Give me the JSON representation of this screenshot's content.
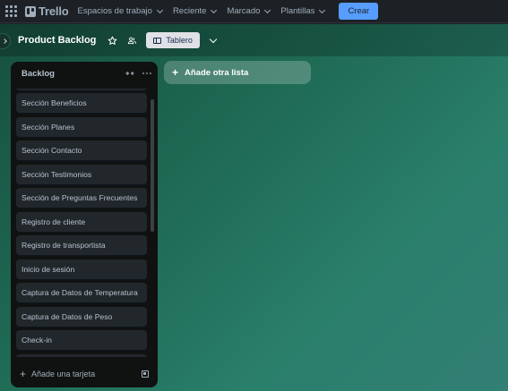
{
  "topbar": {
    "logo": "Trello",
    "nav": [
      {
        "label": "Espacios de trabajo"
      },
      {
        "label": "Reciente"
      },
      {
        "label": "Marcado"
      },
      {
        "label": "Plantillas"
      }
    ],
    "create_label": "Crear"
  },
  "board": {
    "title": "Product Backlog",
    "view_label": "Tablero",
    "add_list_label": "Añade otra lista"
  },
  "list": {
    "title": "Backlog",
    "cards": [
      "Sección Beneficios",
      "Sección Planes",
      "Sección Contacto",
      "Sección Testimonios",
      "Sección de Preguntas Frecuentes",
      "Registro de cliente",
      "Registro de transportista",
      "Inicio de sesión",
      "Captura de Datos de Temperatura",
      "Captura de Datos de Peso",
      "Check-in"
    ],
    "add_card_label": "Añade una tarjeta"
  },
  "icons": {
    "apps": "apps-grid-icon",
    "star": "star-icon",
    "visibility": "workspace-visibility-icon",
    "board": "board-icon",
    "collapse": "collapse-list-icon",
    "more": "more-icon",
    "template": "card-template-icon"
  },
  "colors": {
    "accent": "#579dff",
    "topbar": "#1d2125",
    "list_bg": "#101204",
    "card_bg": "#22272b"
  }
}
